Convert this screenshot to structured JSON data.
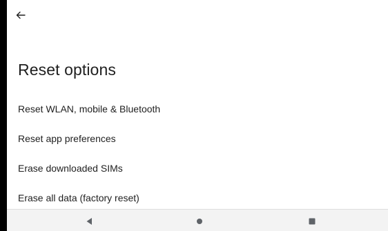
{
  "header": {
    "back_icon": "arrow-back-icon"
  },
  "page": {
    "title": "Reset options"
  },
  "options": [
    {
      "label": "Reset WLAN, mobile & Bluetooth"
    },
    {
      "label": "Reset app preferences"
    },
    {
      "label": "Erase downloaded SIMs"
    },
    {
      "label": "Erase all data (factory reset)"
    }
  ],
  "nav_bar": {
    "back_icon": "nav-back-triangle-icon",
    "home_icon": "nav-home-circle-icon",
    "recents_icon": "nav-recents-square-icon"
  },
  "colors": {
    "text": "#1f1f1f",
    "nav_background": "#f3f3f3",
    "nav_icon": "#5f6368"
  }
}
